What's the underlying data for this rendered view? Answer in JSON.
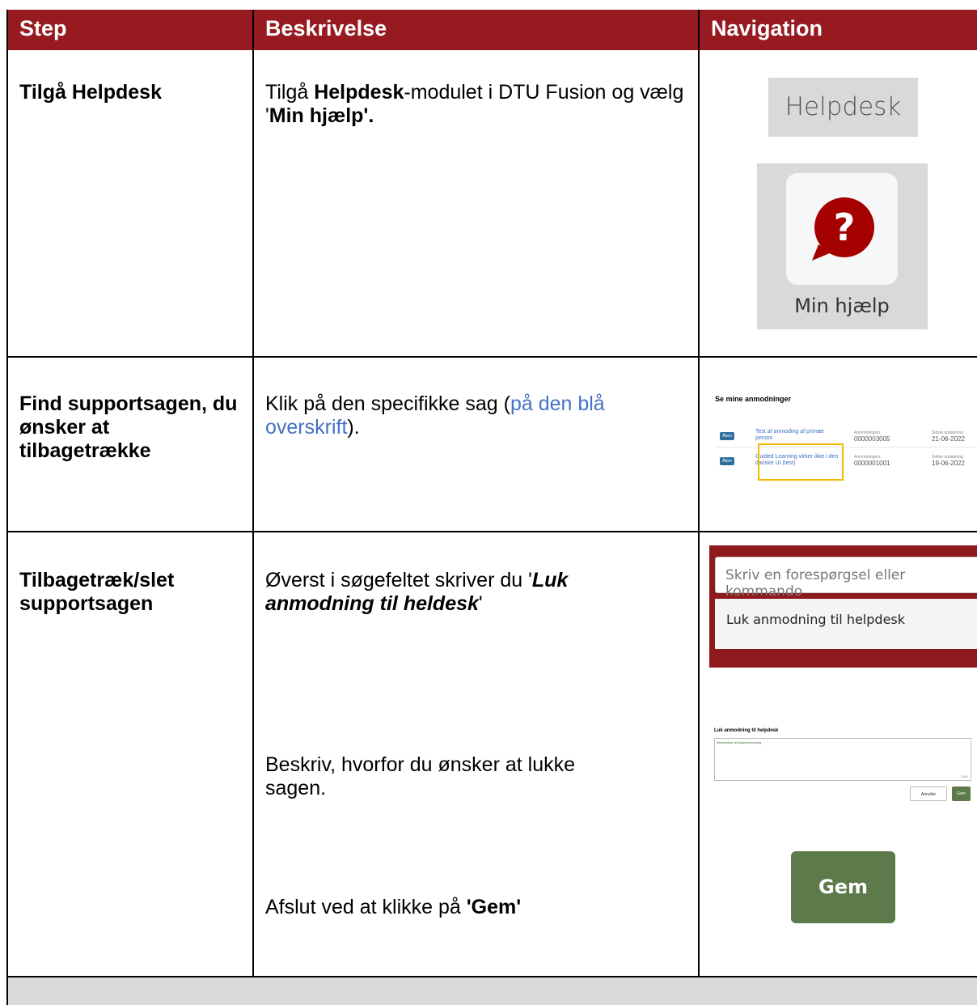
{
  "header": {
    "col1": "Step",
    "col2": "Beskrivelse",
    "col3": "Navigation"
  },
  "rows": [
    {
      "step": "Tilgå Helpdesk",
      "desc": {
        "t1": "Tilgå ",
        "t2": "Helpdesk",
        "t3": "-modulet i DTU Fusion og vælg '",
        "t4": "Min hjælp'."
      },
      "nav": {
        "helpdesk_label": "Helpdesk",
        "minhjaelp_label": "Min hjælp",
        "help_icon": "question-bubble-icon",
        "help_icon_color": "#a50000"
      }
    },
    {
      "step": "Find supportsagen, du ønsker at tilbagetrække",
      "desc": {
        "t1": "Klik på den specifikke sag (",
        "t2": "på den blå overskrift",
        "t3": ")."
      },
      "nav": {
        "list_title": "Se mine anmodninger",
        "items": [
          {
            "badge": "Åben",
            "title": "Test af anmoding af primær person",
            "num_label": "Anmodningsnr.",
            "num": "0000003005",
            "date_label": "Sidste opdatering",
            "date": "21-06-2022"
          },
          {
            "badge": "Åben",
            "title": "Guided Learning virker ikke i den danske UI (test)",
            "num_label": "Anmodningsnr.",
            "num": "0000001001",
            "date_label": "Sidste opdatering",
            "date": "19-06-2022"
          }
        ],
        "highlight_color": "#f5b800"
      }
    },
    {
      "step": "Tilbagetræk/slet supportsagen",
      "desc1": {
        "t1": "Øverst i søgefeltet skriver du '",
        "t2": "Luk anmodning til heldesk",
        "t3": "'"
      },
      "desc2": "Beskriv, hvorfor du ønsker at lukke sagen.",
      "desc3": {
        "t1": "Afslut ved at klikke på ",
        "t2": "'Gem'"
      },
      "nav": {
        "search_placeholder": "Skriv en forespørgsel eller kommando",
        "suggestion": "Luk anmodning til helpdesk",
        "close_title": "Luk anmodning til helpdesk",
        "close_placeholder": "Beskrivelse af lukkeanmodning",
        "close_count": "1000",
        "cancel_label": "Annuller",
        "save_small": "Gem",
        "gem_label": "Gem"
      }
    }
  ]
}
